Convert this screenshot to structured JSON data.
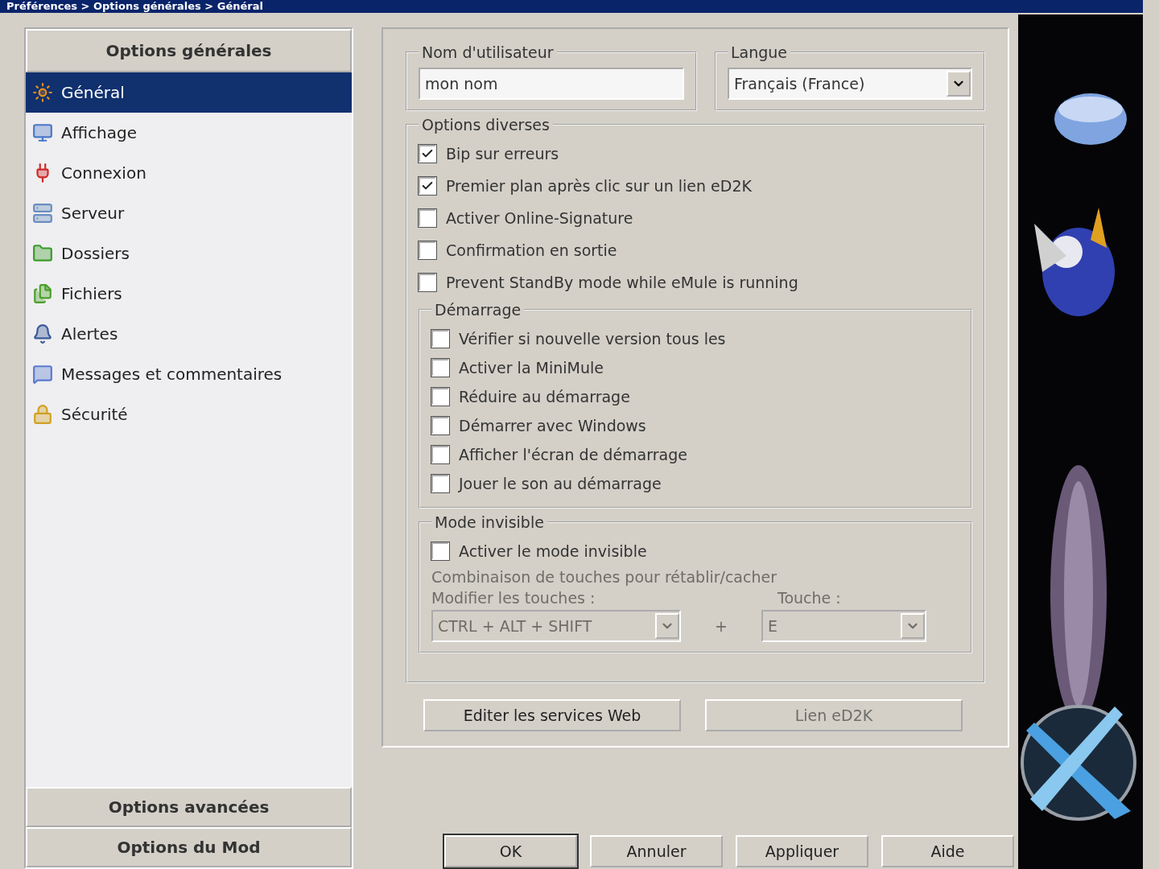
{
  "window": {
    "title": "Préférences > Options générales > Général"
  },
  "sidebar": {
    "header": "Options générales",
    "items": [
      {
        "label": "Général",
        "selected": true
      },
      {
        "label": "Affichage",
        "selected": false
      },
      {
        "label": "Connexion",
        "selected": false
      },
      {
        "label": "Serveur",
        "selected": false
      },
      {
        "label": "Dossiers",
        "selected": false
      },
      {
        "label": "Fichiers",
        "selected": false
      },
      {
        "label": "Alertes",
        "selected": false
      },
      {
        "label": "Messages et commentaires",
        "selected": false
      },
      {
        "label": "Sécurité",
        "selected": false
      }
    ],
    "sections": [
      "Options avancées",
      "Options du Mod"
    ]
  },
  "username": {
    "legend": "Nom d'utilisateur",
    "value": "mon nom"
  },
  "language": {
    "legend": "Langue",
    "value": "Français (France)"
  },
  "misc": {
    "legend": "Options diverses",
    "options": [
      {
        "label": "Bip sur erreurs",
        "checked": true
      },
      {
        "label": "Premier plan après clic sur un lien eD2K",
        "checked": true
      },
      {
        "label": "Activer Online-Signature",
        "checked": false
      },
      {
        "label": "Confirmation en sortie",
        "checked": false
      },
      {
        "label": "Prevent StandBy mode while eMule is running",
        "checked": false
      }
    ]
  },
  "startup": {
    "legend": "Démarrage",
    "options": [
      {
        "label": "Vérifier si nouvelle version tous les",
        "checked": false
      },
      {
        "label": "Activer la MiniMule",
        "checked": false
      },
      {
        "label": "Réduire au démarrage",
        "checked": false
      },
      {
        "label": "Démarrer avec Windows",
        "checked": false
      },
      {
        "label": "Afficher l'écran de démarrage",
        "checked": false
      },
      {
        "label": "Jouer le son au démarrage",
        "checked": false
      }
    ]
  },
  "stealth": {
    "legend": "Mode invisible",
    "option": {
      "label": "Activer le mode invisible",
      "checked": false
    },
    "combo_label": "Combinaison de touches pour rétablir/cacher",
    "modifier_label": "Modifier les touches :",
    "modifier_value": "CTRL + ALT + SHIFT",
    "plus": "+",
    "key_label": "Touche :",
    "key_value": "E",
    "disabled": true
  },
  "web_buttons": [
    {
      "label": "Editer les services Web",
      "disabled": false
    },
    {
      "label": "Lien eD2K",
      "disabled": true
    }
  ],
  "buttons": [
    {
      "label": "OK",
      "default": true
    },
    {
      "label": "Annuler",
      "default": false
    },
    {
      "label": "Appliquer",
      "default": false
    },
    {
      "label": "Aide",
      "default": false
    }
  ]
}
